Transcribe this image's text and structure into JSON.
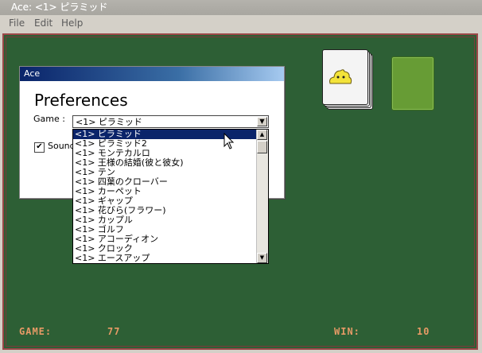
{
  "window": {
    "title": "Ace: <1> ピラミッド"
  },
  "menu": [
    "File",
    "Edit",
    "Help"
  ],
  "dialog": {
    "title": "Ace",
    "heading": "Preferences",
    "game_label": "Game :",
    "selected_game": "<1> ピラミッド",
    "sound_label": "Sound",
    "sound_checked": true
  },
  "game_list": [
    "<1> ピラミッド",
    "<1> ピラミッド2",
    "<1> モンテカルロ",
    "<1> 王様の結婚(彼と彼女)",
    "<1> テン",
    "<1> 四葉のクローバー",
    "<1> カーペット",
    "<1> ギャップ",
    "<1> 花びら(フラワー)",
    "<1> カップル",
    "<1> ゴルフ",
    "<1> アコーディオン",
    "<1> クロック",
    "<1> エースアップ"
  ],
  "stats": {
    "game_label": "GAME:",
    "game_value": "77",
    "win_label": "WIN:",
    "win_value": "10"
  },
  "colors": {
    "felt": "#2d5f35",
    "border": "#9b4848",
    "stat_text": "#e69a66",
    "selection": "#0a246a"
  }
}
